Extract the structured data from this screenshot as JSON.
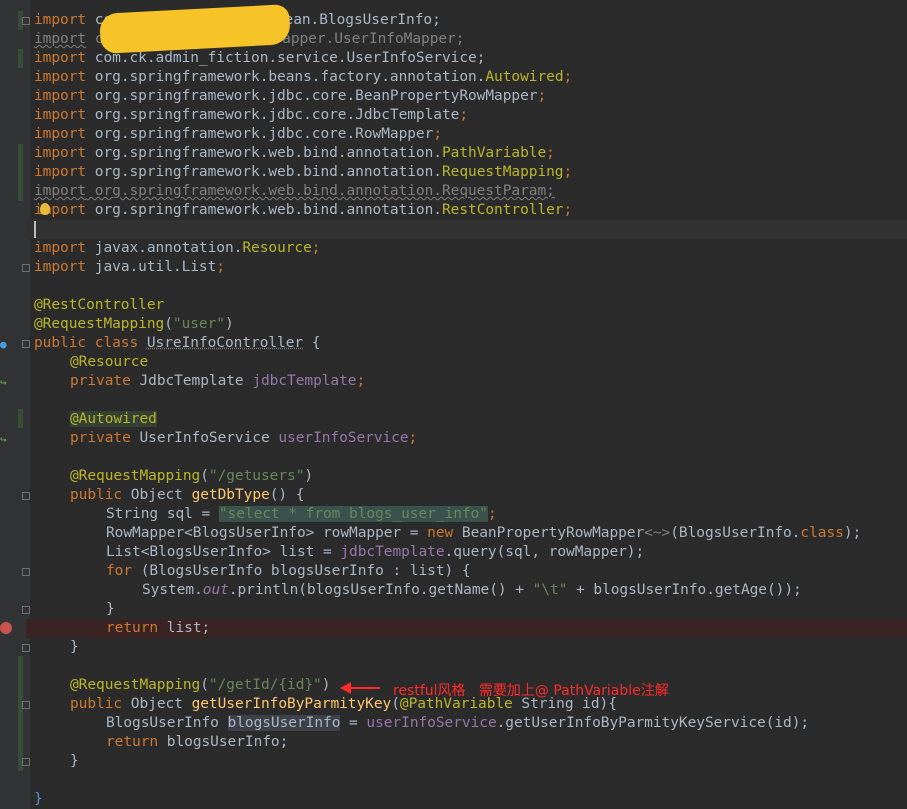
{
  "editor": {
    "language": "java",
    "lines": [
      {
        "kw": "import",
        "rest": " com",
        "tail": "Bean.BlogsUserInfo;"
      },
      {
        "kw": "import",
        "rest": " co",
        "tail": "apper.UserInfoMapper;"
      },
      {
        "kw": "import",
        "rest": " com.ck.admin_fiction.service.UserInfoService;"
      },
      {
        "kw": "import",
        "rest": " org.springframework.beans.factory.annotation.",
        "hl": "Autowired",
        "end": ";"
      },
      {
        "kw": "import",
        "rest": " org.springframework.jdbc.core.BeanPropertyRowMapper",
        "end": ";"
      },
      {
        "kw": "import",
        "rest": " org.springframework.jdbc.core.JdbcTemplate",
        "end": ";"
      },
      {
        "kw": "import",
        "rest": " org.springframework.jdbc.core.RowMapper",
        "end": ";"
      },
      {
        "kw": "import",
        "rest": " org.springframework.web.bind.annotation.",
        "hl": "PathVariable",
        "end": ";"
      },
      {
        "kw": "import",
        "rest": " org.springframework.web.bind.annotation.",
        "hl": "RequestMapping",
        "end": ";"
      },
      {
        "kw": "import",
        "rest": " org.springframework.web.bind.annotation.RequestParam;"
      },
      {
        "kw": "import",
        "rest": " org.springframework.web.bind.annotation.",
        "hl": "RestController",
        "end": ";"
      },
      {
        "kw": "import",
        "rest": " javax.annotation.",
        "hl": "Resource",
        "end": ";"
      },
      {
        "kw": "import",
        "rest": " java.util.List",
        "end": ";"
      }
    ],
    "code": {
      "rest_controller": "@RestController",
      "request_mapping": "@RequestMapping",
      "mapping_value": "\"user\"",
      "class_decl_kw": "public class",
      "class_name": "UsreInfoController",
      "resource_ann": "@Resource",
      "private_kw": "private",
      "jdbc_type": "JdbcTemplate",
      "jdbc_field": "jdbcTemplate",
      "autowired_ann": "@Autowired",
      "service_type": "UserInfoService",
      "service_field": "userInfoService",
      "getusers_path": "\"/getusers\"",
      "public_kw": "public",
      "object_type": "Object",
      "method1": "getDbType",
      "string_sql": "String sql = ",
      "sql_value": "\"select * from blogs_user_info\"",
      "rowmapper_decl": "RowMapper<BlogsUserInfo> rowMapper = ",
      "new_kw": "new",
      "bprm": " BeanPropertyRowMapper",
      "diamond": "<~>",
      "bprm_arg": "(BlogsUserInfo.",
      "class_kw": "class",
      "list_decl": "List<BlogsUserInfo> list = ",
      "query_call": ".query(sql, rowMapper);",
      "for_kw": "for",
      "for_body": " (BlogsUserInfo blogsUserInfo : list) {",
      "sysout_a": "System.",
      "out_field": "out",
      "println": ".println(blogsUserInfo.getName() + ",
      "tab_str": "\"\\t\"",
      "println_end": " + blogsUserInfo.getAge());",
      "close_brace": "}",
      "return_kw": "return",
      "return_list": " list;",
      "getid_path": "\"/getId/{id}\"",
      "method2": "getUserInfoByParmityKey",
      "pathvar_ann": "@PathVariable",
      "method2_params": " String id){",
      "bui_type": "BlogsUserInfo ",
      "bui_var": "blogsUserInfo",
      "bui_assign": " = ",
      "bui_call": ".getUserInfoByParmityKeyService(id);",
      "return_bui": " blogsUserInfo;"
    },
    "annotation_note": "restful风格   需要加上@ PathVariable注解",
    "colors": {
      "background": "#2b2b2b",
      "keyword": "#cc7832",
      "annotation": "#bbb529",
      "string": "#6a8759",
      "field": "#9876aa",
      "method": "#ffc66d",
      "text": "#a9b7c6",
      "note": "#ff2a2a",
      "redaction": "#f6c428"
    }
  }
}
